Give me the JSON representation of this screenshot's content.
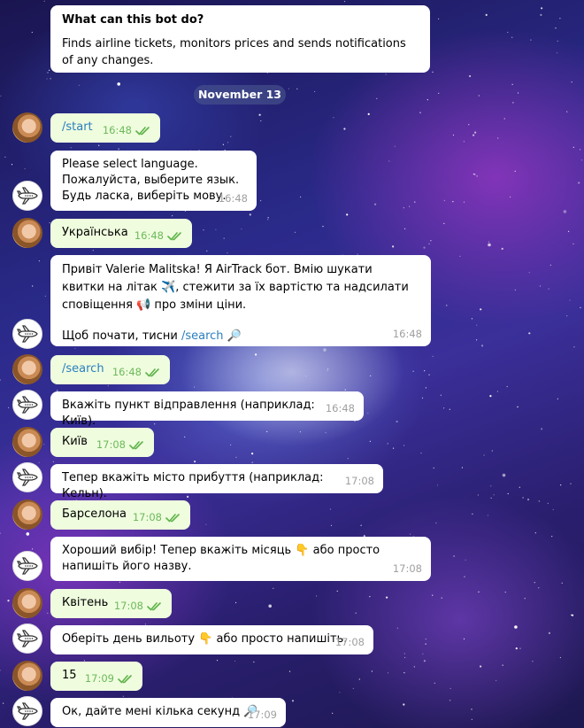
{
  "bot_info": {
    "title": "What can this bot do?",
    "description": "Finds airline tickets, monitors prices and sends notifications of any changes."
  },
  "date_separator": "November 13",
  "messages": [
    {
      "from": "user",
      "text": "/start",
      "time": "16:48"
    },
    {
      "from": "bot",
      "text": "Please select language.\nПожалуйста, выберите язык.\nБудь ласка, виберіть мову.",
      "time": "16:48"
    },
    {
      "from": "user",
      "text": "Українська",
      "time": "16:48"
    },
    {
      "from": "bot",
      "text_part1": "Привіт Valerie Malitska! Я AirTrack бот. Вмію шукати квитки на літак ✈️, стежити за їх вартістю та надсилати сповіщення 📢 про зміни ціни.",
      "text_part2": "Щоб почати, тисни ",
      "cmd": "/search",
      "text_part3": " 🔎",
      "time": "16:48"
    },
    {
      "from": "user",
      "text": "/search",
      "time": "16:48"
    },
    {
      "from": "bot",
      "text": "Вкажіть пункт відправлення (наприклад: Київ).",
      "time": "16:48"
    },
    {
      "from": "user",
      "text": "Київ",
      "time": "17:08"
    },
    {
      "from": "bot",
      "text": "Тепер вкажіть місто прибуття (наприклад: Кельн).",
      "time": "17:08"
    },
    {
      "from": "user",
      "text": "Барселона",
      "time": "17:08"
    },
    {
      "from": "bot",
      "text": "Хороший вибір! Тепер вкажіть місяць 👇 або просто напишіть його назву.",
      "time": "17:08"
    },
    {
      "from": "user",
      "text": "Квітень",
      "time": "17:08"
    },
    {
      "from": "bot",
      "text": "Оберіть день вильоту 👇 або просто напишіть.",
      "time": "17:08"
    },
    {
      "from": "user",
      "text": "15",
      "time": "17:09"
    },
    {
      "from": "bot",
      "text": "Ок, дайте мені кілька секунд 🔎",
      "time": "17:09"
    }
  ],
  "icons": {
    "user_avatar": "user-avatar",
    "bot_avatar": "airplane-icon",
    "read_status": "double-check-icon"
  },
  "colors": {
    "incoming_bubble": "#ffffff",
    "outgoing_bubble": "#effdde",
    "command_link": "#2a7fbf",
    "read_check": "#6cb95a"
  }
}
